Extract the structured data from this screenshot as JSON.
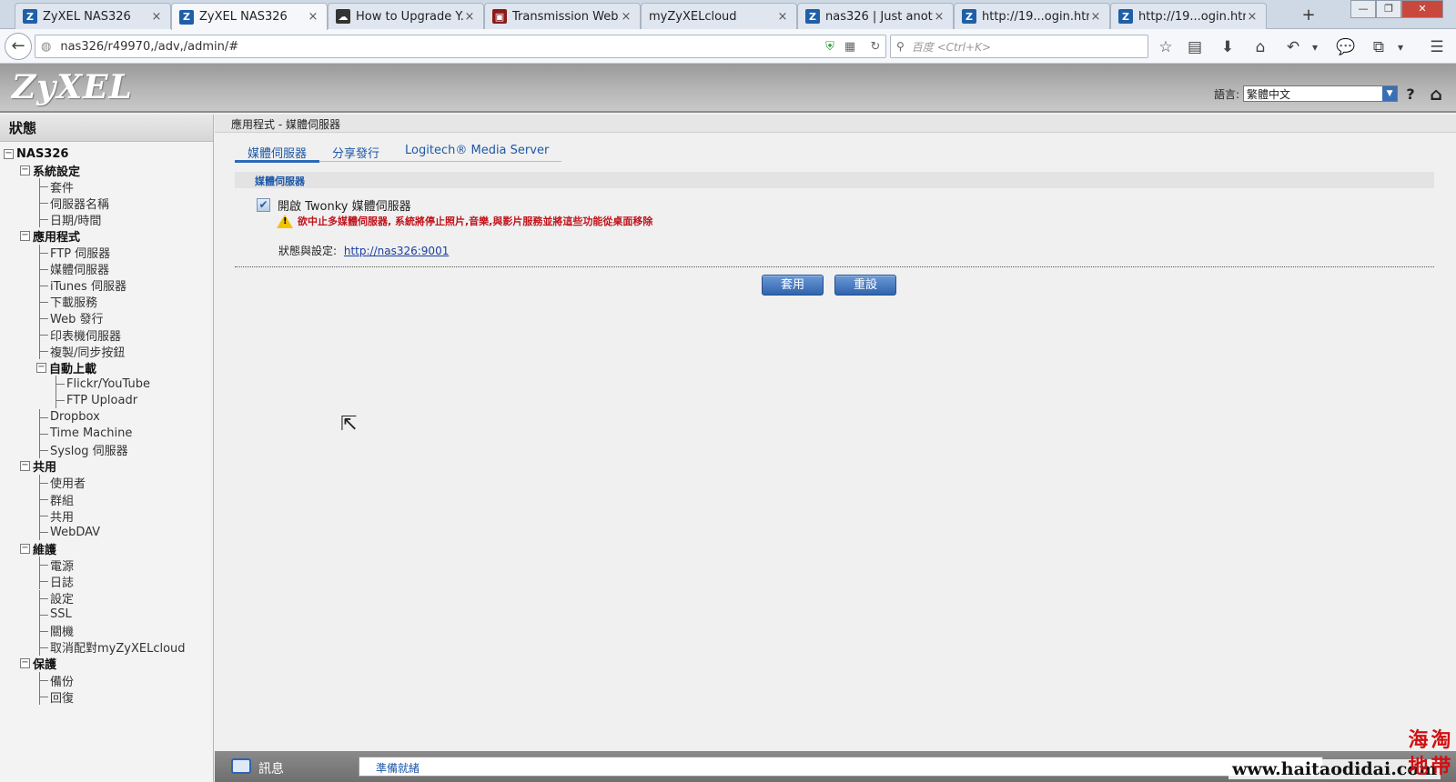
{
  "browser": {
    "tabs": [
      {
        "label": "ZyXEL NAS326",
        "icon": "zyxel-favicon",
        "glyph": "Z",
        "active": false
      },
      {
        "label": "ZyXEL NAS326",
        "icon": "zyxel-favicon",
        "glyph": "Z",
        "active": true
      },
      {
        "label": "How to Upgrade Y...",
        "icon": "cloud-favicon",
        "glyph": "☁",
        "active": false
      },
      {
        "label": "Transmission Web...",
        "icon": "transmission-favicon",
        "glyph": "▣",
        "active": false
      },
      {
        "label": "myZyXELcloud",
        "icon": "none",
        "glyph": "",
        "active": false
      },
      {
        "label": "nas326 | Just anot...",
        "icon": "zyxel-favicon",
        "glyph": "Z",
        "active": false
      },
      {
        "label": "http://19...ogin.html",
        "icon": "zyxel-favicon",
        "glyph": "Z",
        "active": false
      },
      {
        "label": "http://19...ogin.html",
        "icon": "zyxel-favicon",
        "glyph": "Z",
        "active": false
      }
    ],
    "close_glyph": "×",
    "new_tab_glyph": "+",
    "window_controls": {
      "minimize": "—",
      "maximize": "❐",
      "close": "✕"
    },
    "url": "nas326/r49970,/adv,/admin/#",
    "search_placeholder": "百度 <Ctrl+K>",
    "back_glyph": "←",
    "toolbar_glyphs": {
      "star": "☆",
      "reading_list": "▤",
      "download": "⬇",
      "home": "⌂",
      "undo": "↶",
      "dropdown": "▾",
      "chat": "💬",
      "crop": "⧉",
      "menu": "☰",
      "refresh": "↻",
      "qr": "▦",
      "shield": "⛨",
      "globe": "◍",
      "search": "⚲"
    }
  },
  "header": {
    "logo": "ZyXEL",
    "language_label": "語言:",
    "language_value": "繁體中文",
    "help_glyph": "?",
    "home_glyph": "⌂"
  },
  "sidebar": {
    "title": "狀態",
    "tree": [
      {
        "label": "NAS326",
        "level": 0,
        "toggle": true
      },
      {
        "label": "系統設定",
        "level": 1,
        "toggle": true
      },
      {
        "label": "套件",
        "level": 2
      },
      {
        "label": "伺服器名稱",
        "level": 2
      },
      {
        "label": "日期/時間",
        "level": 2
      },
      {
        "label": "應用程式",
        "level": 1,
        "toggle": true
      },
      {
        "label": "FTP 伺服器",
        "level": 2
      },
      {
        "label": "媒體伺服器",
        "level": 2
      },
      {
        "label": "iTunes 伺服器",
        "level": 2
      },
      {
        "label": "下載服務",
        "level": 2
      },
      {
        "label": "Web 發行",
        "level": 2
      },
      {
        "label": "印表機伺服器",
        "level": 2
      },
      {
        "label": "複製/同步按鈕",
        "level": 2
      },
      {
        "label": "自動上載",
        "level": 2,
        "toggle": true
      },
      {
        "label": "Flickr/YouTube",
        "level": 3
      },
      {
        "label": "FTP Uploadr",
        "level": 3
      },
      {
        "label": "Dropbox",
        "level": 2
      },
      {
        "label": "Time Machine",
        "level": 2
      },
      {
        "label": "Syslog 伺服器",
        "level": 2
      },
      {
        "label": "共用",
        "level": 1,
        "toggle": true
      },
      {
        "label": "使用者",
        "level": 2
      },
      {
        "label": "群組",
        "level": 2
      },
      {
        "label": "共用",
        "level": 2
      },
      {
        "label": "WebDAV",
        "level": 2
      },
      {
        "label": "維護",
        "level": 1,
        "toggle": true
      },
      {
        "label": "電源",
        "level": 2
      },
      {
        "label": "日誌",
        "level": 2
      },
      {
        "label": "設定",
        "level": 2
      },
      {
        "label": "SSL",
        "level": 2
      },
      {
        "label": "關機",
        "level": 2
      },
      {
        "label": "取消配對myZyXELcloud",
        "level": 2
      },
      {
        "label": "保護",
        "level": 1,
        "toggle": true
      },
      {
        "label": "備份",
        "level": 2
      },
      {
        "label": "回復",
        "level": 2
      }
    ],
    "toggle_glyph": "−"
  },
  "main": {
    "breadcrumb": "應用程式 - 媒體伺服器",
    "tabs": [
      {
        "label": "媒體伺服器",
        "active": true
      },
      {
        "label": "分享發行",
        "active": false
      },
      {
        "label": "Logitech® Media Server",
        "active": false
      }
    ],
    "section_title": "媒體伺服器",
    "enable_label": "開啟 Twonky 媒體伺服器",
    "enable_checked": true,
    "check_glyph": "✔",
    "warning_glyph": "!",
    "warning_text": "欲中止多媒體伺服器, 系統將停止照片,音樂,與影片服務並將這些功能從桌面移除",
    "status_label": "狀態與設定:",
    "status_link": "http://nas326:9001",
    "apply_button": "套用",
    "reset_button": "重設",
    "cursor_glyph": "⇱"
  },
  "statusbar": {
    "label": "訊息",
    "message": "準備就緒"
  },
  "watermark": {
    "url": "www.haitaodidai.com",
    "logo_chars": [
      "海",
      "淘",
      "地",
      "带"
    ]
  },
  "colors": {
    "link_blue": "#1e58a6",
    "warning_red": "#c0121b",
    "button_blue": "#2f63ae"
  }
}
